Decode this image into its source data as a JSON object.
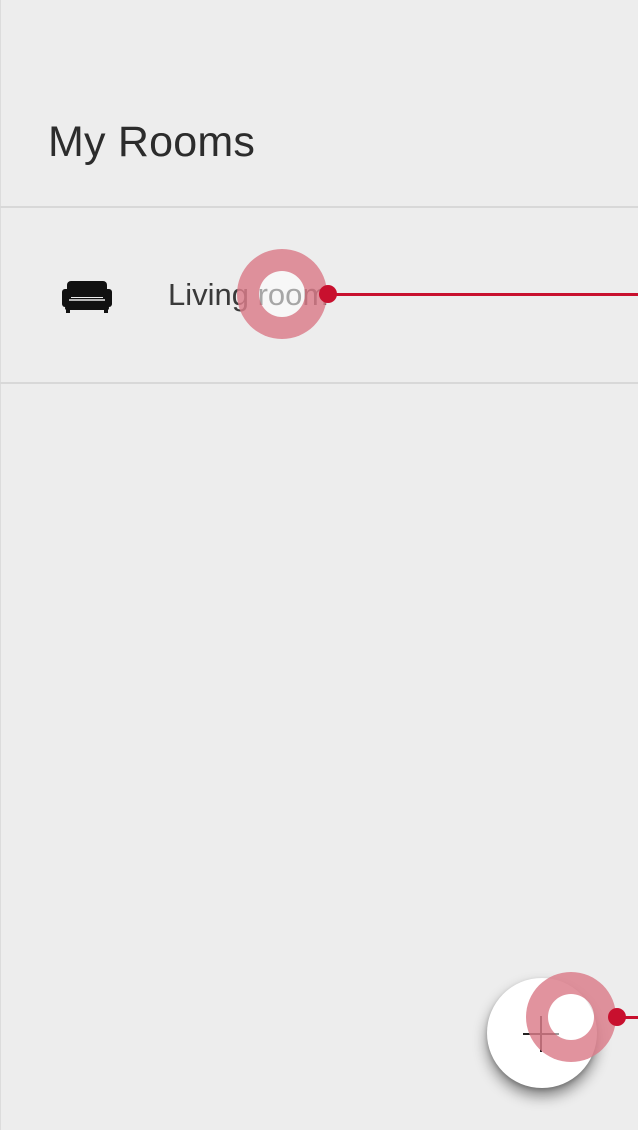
{
  "header": {
    "title": "My Rooms"
  },
  "rooms": [
    {
      "label": "Living room",
      "icon": "sofa-icon"
    }
  ],
  "fab": {
    "icon": "plus-icon"
  },
  "overlay": {
    "touch_color": "#c8102e"
  }
}
